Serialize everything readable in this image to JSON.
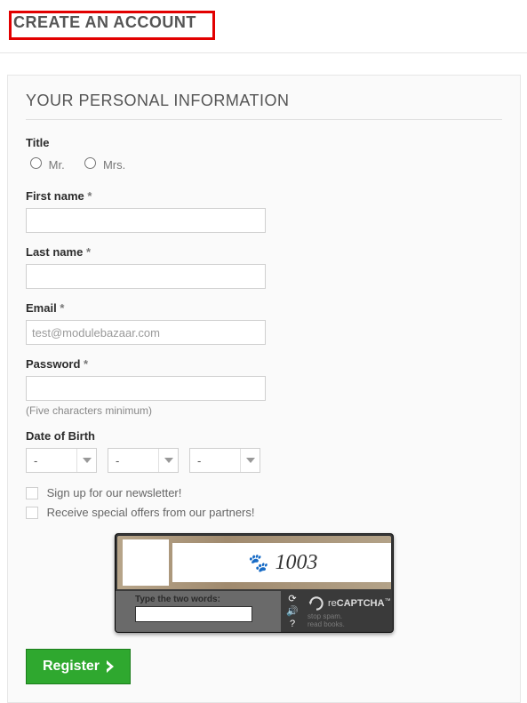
{
  "header": {
    "title": "CREATE AN ACCOUNT"
  },
  "section": {
    "title": "YOUR PERSONAL INFORMATION"
  },
  "title_field": {
    "label": "Title",
    "options": [
      "Mr.",
      "Mrs."
    ]
  },
  "first_name": {
    "label": "First name",
    "value": ""
  },
  "last_name": {
    "label": "Last name",
    "value": ""
  },
  "email": {
    "label": "Email",
    "value": "test@modulebazaar.com"
  },
  "password": {
    "label": "Password",
    "hint": "(Five characters minimum)"
  },
  "dob": {
    "label": "Date of Birth",
    "day": "-",
    "month": "-",
    "year": "-"
  },
  "checks": {
    "newsletter": "Sign up for our newsletter!",
    "offers": "Receive special offers from our partners!"
  },
  "captcha": {
    "display_text": "1003",
    "prompt": "Type the two words:",
    "brand_prefix": "re",
    "brand_name": "CAPTCHA",
    "tagline1": "stop spam.",
    "tagline2": "read books."
  },
  "register": {
    "label": "Register"
  },
  "required_mark": "*"
}
